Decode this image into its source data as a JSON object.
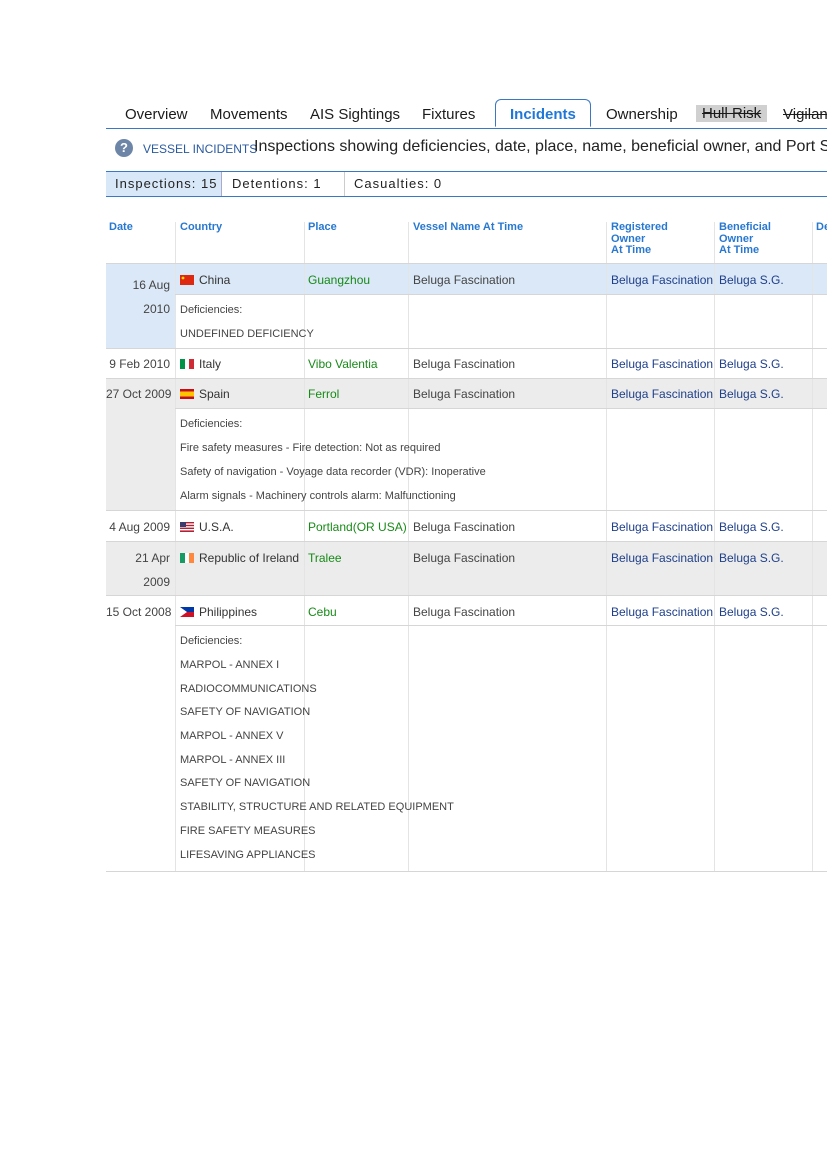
{
  "tabs": [
    {
      "label": "Overview"
    },
    {
      "label": "Movements"
    },
    {
      "label": "AIS Sightings"
    },
    {
      "label": "Fixtures"
    },
    {
      "label": "Incidents",
      "active": true
    },
    {
      "label": "Ownership"
    },
    {
      "label": "Hull Risk"
    },
    {
      "label": "Vigilan"
    }
  ],
  "section": {
    "icon": "question-icon",
    "title": "VESSEL INCIDENTS",
    "description": "Inspections showing deficiencies, date, place, name, beneficial owner, and Port State"
  },
  "counts": {
    "inspections": "Inspections: 15",
    "detentions": "Detentions: 1",
    "casualties": "Casualties: 0"
  },
  "columns": {
    "date": "Date",
    "country": "Country",
    "place": "Place",
    "vessel": "Vessel Name At Time",
    "registered_owner": [
      "Registered",
      "Owner",
      "At Time"
    ],
    "beneficial_owner": [
      "Beneficial",
      "Owner",
      "At Time"
    ],
    "extra": "De"
  },
  "colors": {
    "accent": "#2878d0",
    "highlight_row": "#dbe8f7",
    "alt_row": "#ececec",
    "place": "#178a17",
    "owner": "#1f3f8a"
  },
  "rows": [
    {
      "date": [
        "16 Aug",
        "2010"
      ],
      "country": "China",
      "flag": "china-flag",
      "place": "Guangzhou",
      "vessel": "Beluga Fascination",
      "registered_owner": "Beluga Fascination",
      "beneficial_owner": "Beluga S.G.",
      "deficiencies_label": "Deficiencies:",
      "deficiencies": [
        "UNDEFINED DEFICIENCY"
      ]
    },
    {
      "date": [
        "9 Feb 2010"
      ],
      "country": "Italy",
      "flag": "italy-flag",
      "place": "Vibo Valentia",
      "vessel": "Beluga Fascination",
      "registered_owner": "Beluga Fascination",
      "beneficial_owner": "Beluga S.G."
    },
    {
      "date": [
        "27 Oct 2009"
      ],
      "country": "Spain",
      "flag": "spain-flag",
      "place": "Ferrol",
      "vessel": "Beluga Fascination",
      "registered_owner": "Beluga Fascination",
      "beneficial_owner": "Beluga S.G.",
      "deficiencies_label": "Deficiencies:",
      "deficiencies": [
        "Fire safety measures - Fire detection: Not as required",
        "Safety of navigation - Voyage data recorder (VDR): Inoperative",
        "Alarm signals - Machinery controls alarm: Malfunctioning"
      ]
    },
    {
      "date": [
        "4 Aug 2009"
      ],
      "country": "U.S.A.",
      "flag": "usa-flag",
      "place": "Portland(OR USA)",
      "vessel": "Beluga Fascination",
      "registered_owner": "Beluga Fascination",
      "beneficial_owner": "Beluga S.G."
    },
    {
      "date": [
        "21 Apr",
        "2009"
      ],
      "country": "Republic of Ireland",
      "flag": "ireland-flag",
      "place": "Tralee",
      "vessel": "Beluga Fascination",
      "registered_owner": "Beluga Fascination",
      "beneficial_owner": "Beluga S.G."
    },
    {
      "date": [
        "15 Oct 2008"
      ],
      "country": "Philippines",
      "flag": "philippines-flag",
      "place": "Cebu",
      "vessel": "Beluga Fascination",
      "registered_owner": "Beluga Fascination",
      "beneficial_owner": "Beluga S.G.",
      "deficiencies_label": "Deficiencies:",
      "deficiencies": [
        "MARPOL - ANNEX I",
        "RADIOCOMMUNICATIONS",
        "SAFETY OF NAVIGATION",
        "MARPOL - ANNEX V",
        "MARPOL - ANNEX III",
        "SAFETY OF NAVIGATION",
        "STABILITY, STRUCTURE AND RELATED EQUIPMENT",
        "FIRE SAFETY MEASURES",
        "LIFESAVING APPLIANCES"
      ]
    }
  ]
}
